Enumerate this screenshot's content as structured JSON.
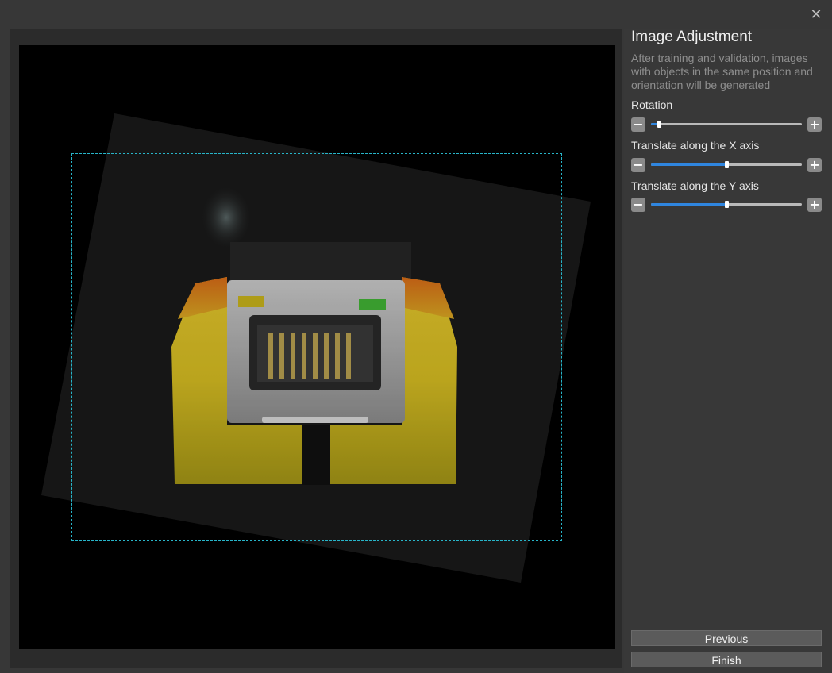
{
  "window": {
    "close_icon": "close-icon"
  },
  "panel": {
    "title": "Image Adjustment",
    "description": "After training and validation, images with objects in the same position and orientation will be generated"
  },
  "sliders": [
    {
      "label": "Rotation",
      "value": 0.05
    },
    {
      "label": "Translate along the X axis",
      "value": 0.5
    },
    {
      "label": "Translate along the Y axis",
      "value": 0.5
    }
  ],
  "buttons": {
    "previous": "Previous",
    "finish": "Finish"
  },
  "colors": {
    "accent": "#2f86e0",
    "roi": "#27b5c9",
    "panel_bg": "#383838"
  }
}
